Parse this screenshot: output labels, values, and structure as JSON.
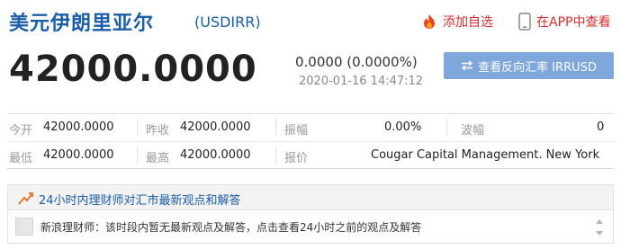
{
  "header": {
    "title": "美元伊朗里亚尔",
    "code": "(USDIRR)",
    "add_watch_label": "添加自选",
    "app_view_label": "在APP中查看"
  },
  "quote": {
    "price": "42000.0000",
    "change": "0.0000 (0.0000%)",
    "timestamp": "2020-01-16 14:47:12",
    "reverse_button": "查看反向汇率 IRRUSD"
  },
  "stats": {
    "open_label": "今开",
    "open_value": "42000.0000",
    "prev_close_label": "昨收",
    "prev_close_value": "42000.0000",
    "amplitude_label": "振幅",
    "amplitude_value": "0.00%",
    "wave_label": "波幅",
    "wave_value": "0",
    "low_label": "最低",
    "low_value": "42000.0000",
    "high_label": "最高",
    "high_value": "42000.0000",
    "quote_label": "报价",
    "quote_value": "Cougar Capital Management. New York"
  },
  "qa": {
    "title": "24小时内理财师对汇市最新观点和解答",
    "message": "新浪理财师：该时段内暂无最新观点及解答，点击查看24小时之前的观点及解答"
  },
  "colors": {
    "brand_blue": "#1a5da8",
    "action_red": "#d52d2d",
    "button_blue": "#7fa7dc"
  },
  "icons": [
    "flame-icon",
    "phone-icon",
    "swap-icon",
    "trend-icon",
    "avatar",
    "scroll-arrows-icon"
  ]
}
